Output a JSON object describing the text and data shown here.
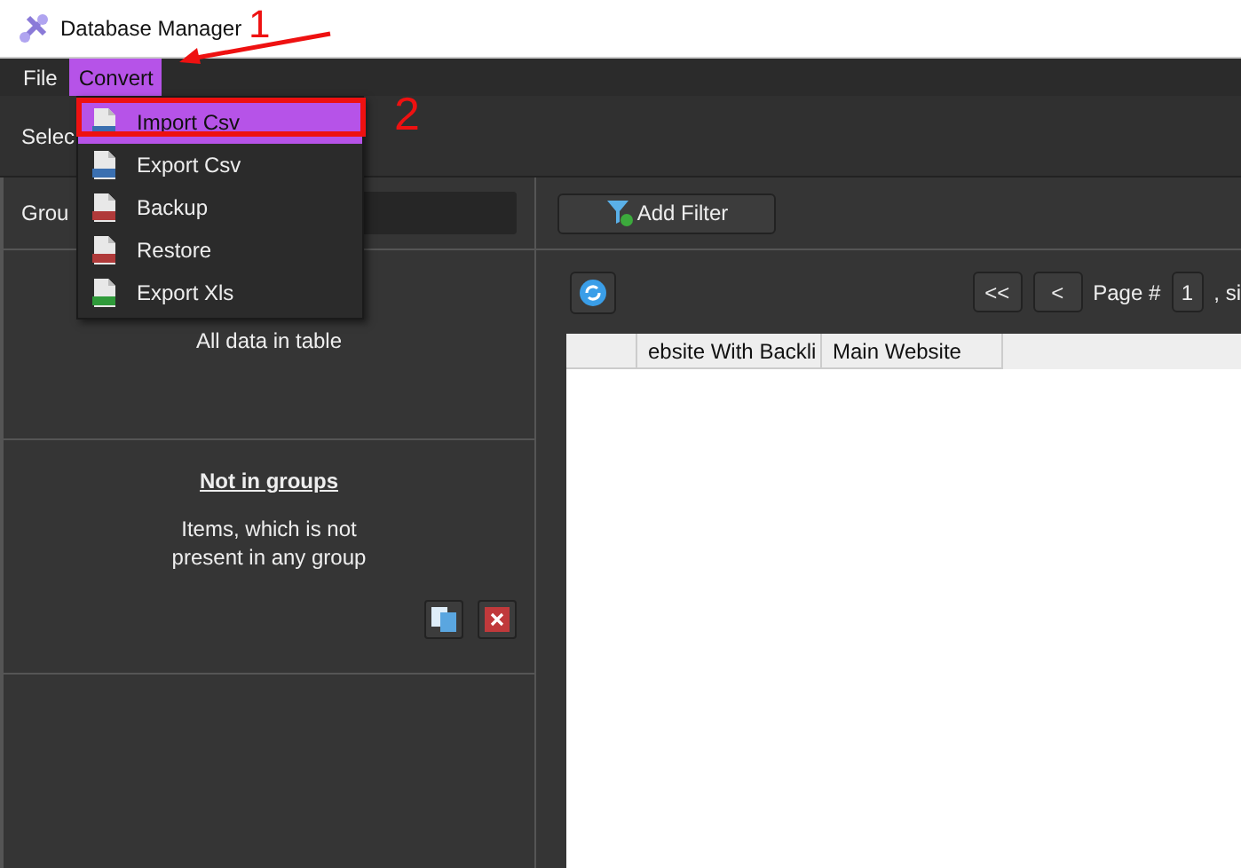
{
  "window": {
    "title": "Database Manager"
  },
  "menu_bar": [
    {
      "label": "File",
      "selected": false
    },
    {
      "label": "Convert",
      "selected": true
    }
  ],
  "toolbar": {
    "label": "Selec"
  },
  "convert_menu": [
    {
      "label": "Import Csv",
      "kind": "csv",
      "selected": true
    },
    {
      "label": "Export Csv",
      "kind": "csv",
      "selected": false
    },
    {
      "label": "Backup",
      "kind": "sql",
      "selected": false
    },
    {
      "label": "Restore",
      "kind": "sql",
      "selected": false
    },
    {
      "label": "Export Xls",
      "kind": "xls",
      "selected": false
    }
  ],
  "groups_panel": {
    "label": "Grou",
    "cards": [
      {
        "description": "All data in table"
      },
      {
        "title": "Not in groups",
        "description": "Items, which is not present in any group",
        "actions": true
      }
    ]
  },
  "filter": {
    "button": "Add Filter"
  },
  "pager": {
    "first": "<<",
    "prev": "<",
    "label": "Page #",
    "page": "1",
    "suffix": ", si"
  },
  "table": {
    "columns": [
      "",
      "ebsite With Backli",
      "Main Website"
    ]
  },
  "annotations": [
    {
      "text": "1"
    },
    {
      "text": "2"
    }
  ]
}
